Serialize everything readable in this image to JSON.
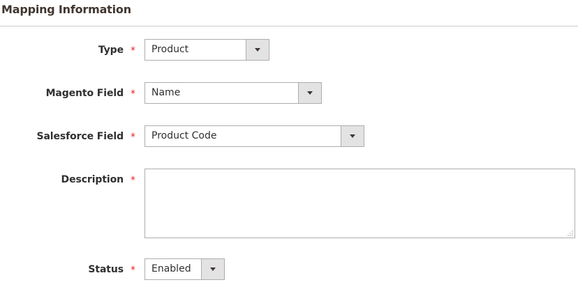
{
  "section": {
    "title": "Mapping Information"
  },
  "required_marker": "*",
  "fields": {
    "type": {
      "label": "Type",
      "value": "Product"
    },
    "magento_field": {
      "label": "Magento Field",
      "value": "Name"
    },
    "salesforce_field": {
      "label": "Salesforce Field",
      "value": "Product Code"
    },
    "description": {
      "label": "Description",
      "value": ""
    },
    "status": {
      "label": "Status",
      "value": "Enabled"
    }
  },
  "colors": {
    "required_star": "#e22626",
    "border": "#adadad",
    "select_button_bg": "#e3e3e3",
    "section_rule": "#cccccc"
  },
  "icons": {
    "dropdown": "chevron-down-icon",
    "resize": "resize-grip-icon"
  }
}
